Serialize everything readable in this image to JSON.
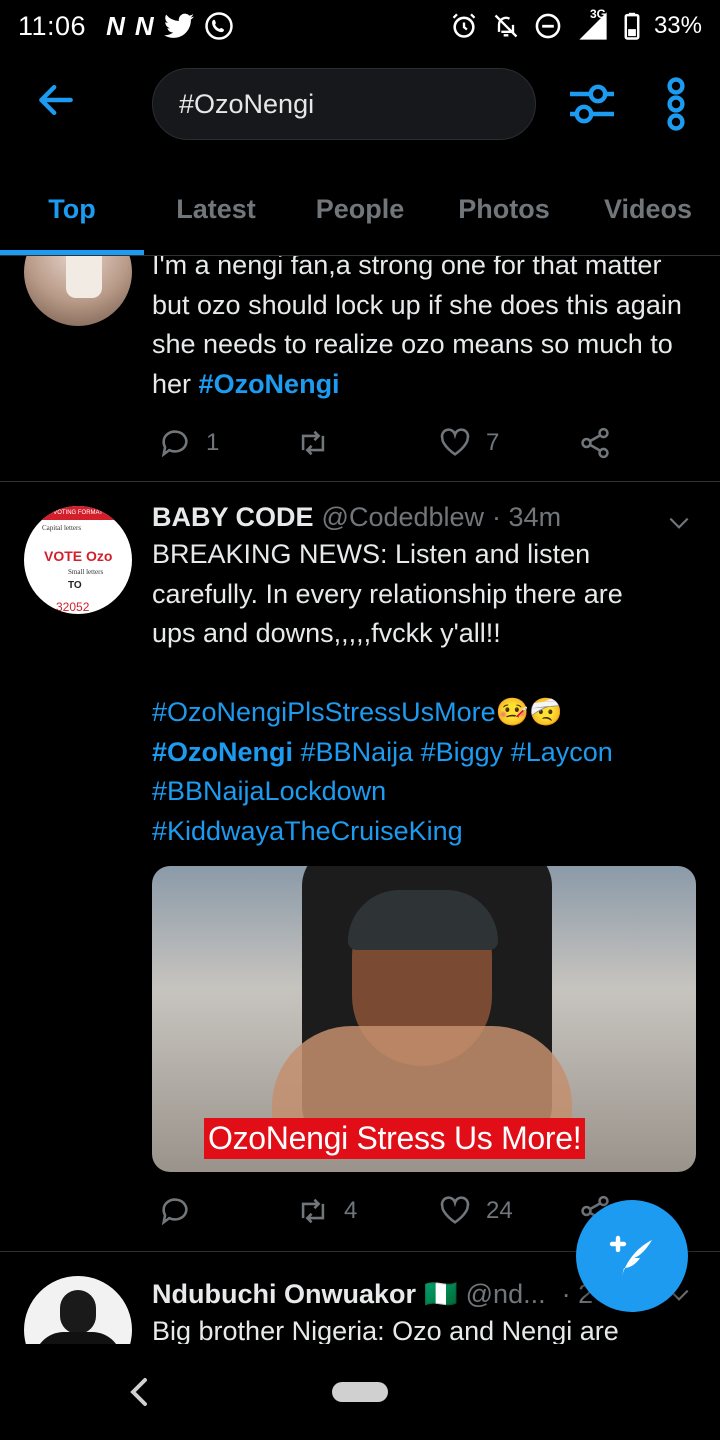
{
  "status_bar": {
    "time": "11:06",
    "left_icons": [
      "n-icon",
      "n-icon",
      "twitter-icon",
      "whatsapp-icon"
    ],
    "network": "3G",
    "battery": "33%"
  },
  "header": {
    "search_value": "#OzoNengi"
  },
  "tabs": [
    "Top",
    "Latest",
    "People",
    "Photos",
    "Videos"
  ],
  "active_tab": "Top",
  "tweets": [
    {
      "text_plain": "I'm a nengi fan,a strong one for that matter but ozo should lock up if she does this again she needs to realize ozo means so much to her",
      "hashtag": "#OzoNengi",
      "replies": "1",
      "retweets": "",
      "likes": "7"
    },
    {
      "name": "BABY CODE",
      "handle": "@Codedblew",
      "time": "· 34m",
      "avatar_text": {
        "top": "VOTING FORMAT",
        "caps": "Capital letters",
        "vote": "VOTE Ozo",
        "small": "Small letters",
        "to": "TO",
        "num": "32052"
      },
      "line1": "BREAKING NEWS: Listen and listen",
      "line2": "carefully. In every relationship there are",
      "line3": "ups and downs,,,,,fvckk y'all!!",
      "tag1": "#OzoNengiPlsStressUsMore",
      "emojis": "🤒🤕",
      "tag2": "#OzoNengi",
      "tag3": "#BBNaija",
      "tag4": "#Biggy",
      "tag5": "#Laycon",
      "tag6": "#BBNaijaLockdown",
      "tag7": "#KiddwayaTheCruiseKing",
      "media_caption": "OzoNengi Stress Us More!",
      "replies": "",
      "retweets": "4",
      "likes": "24"
    },
    {
      "name": "Ndubuchi Onwuakor",
      "flag": "🇳🇬",
      "handle": "@nd...",
      "time": "· 2",
      "text": "Big brother Nigeria: Ozo and Nengi are"
    }
  ],
  "colors": {
    "accent": "#1d9bf0",
    "background": "#000000",
    "muted": "#71767b",
    "caption_bg": "#e10d17"
  }
}
